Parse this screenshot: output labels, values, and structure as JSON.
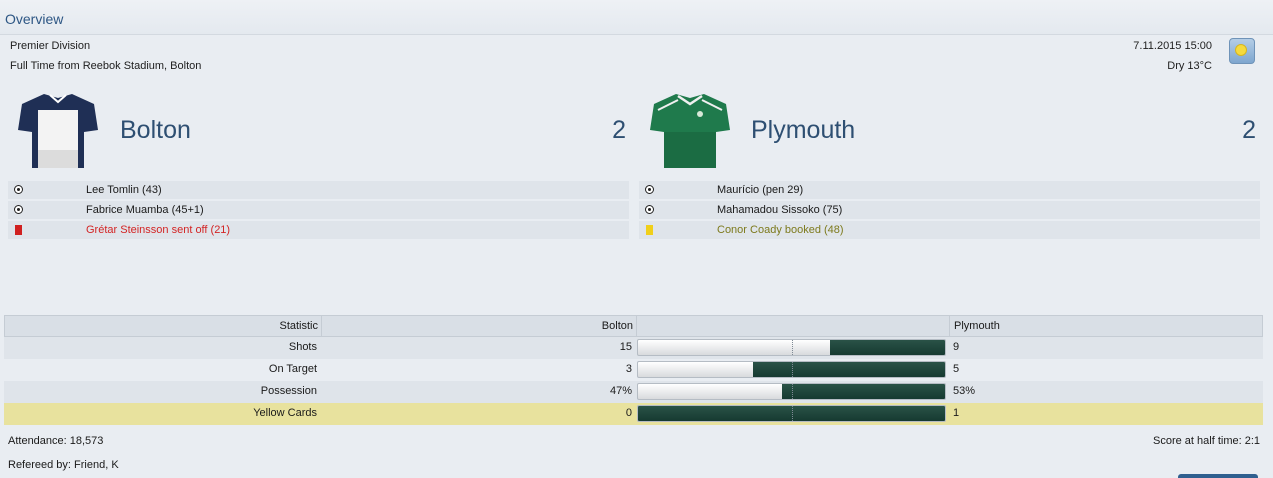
{
  "panel": {
    "title": "Overview"
  },
  "match": {
    "competition": "Premier Division",
    "result": "Full Time from Reebok Stadium, Bolton",
    "datetime": "7.11.2015 15:00",
    "weather": "Dry 13°C",
    "weather_icon": "sunny-weather-icon"
  },
  "home": {
    "name": "Bolton",
    "score": "2",
    "kit_colors": {
      "body": "#f2f2f2",
      "sleeves": "#1f2f55"
    },
    "events": [
      {
        "type": "goal",
        "text": "Lee Tomlin (43)"
      },
      {
        "type": "goal",
        "text": "Fabrice Muamba (45+1)"
      },
      {
        "type": "red-card",
        "text": "Grétar Steinsson sent off (21)"
      }
    ]
  },
  "away": {
    "name": "Plymouth",
    "score": "2",
    "kit_colors": {
      "body": "#1f7a4c",
      "trim": "#f0f0f0"
    },
    "events": [
      {
        "type": "goal",
        "text": "Maurício (pen 29)"
      },
      {
        "type": "goal",
        "text": "Mahamadou Sissoko (75)"
      },
      {
        "type": "yellow-card",
        "text": "Conor Coady booked (48)"
      }
    ]
  },
  "stats": {
    "headers": {
      "statistic": "Statistic",
      "home": "Bolton",
      "away": "Plymouth"
    },
    "rows": [
      {
        "label": "Shots",
        "home": "15",
        "away": "9",
        "away_share": 0.375
      },
      {
        "label": "On Target",
        "home": "3",
        "away": "5",
        "away_share": 0.625
      },
      {
        "label": "Possession",
        "home": "47%",
        "away": "53%",
        "away_share": 0.53
      },
      {
        "label": "Yellow Cards",
        "home": "0",
        "away": "1",
        "away_share": 1.0
      }
    ],
    "colors": {
      "bar_fill": "#1d463b",
      "highlight_row": "#e8e29e"
    }
  },
  "footer": {
    "attendance": "Attendance: 18,573",
    "referee": "Refereed by: Friend, K",
    "half_time": "Score at half time: 2:1"
  }
}
